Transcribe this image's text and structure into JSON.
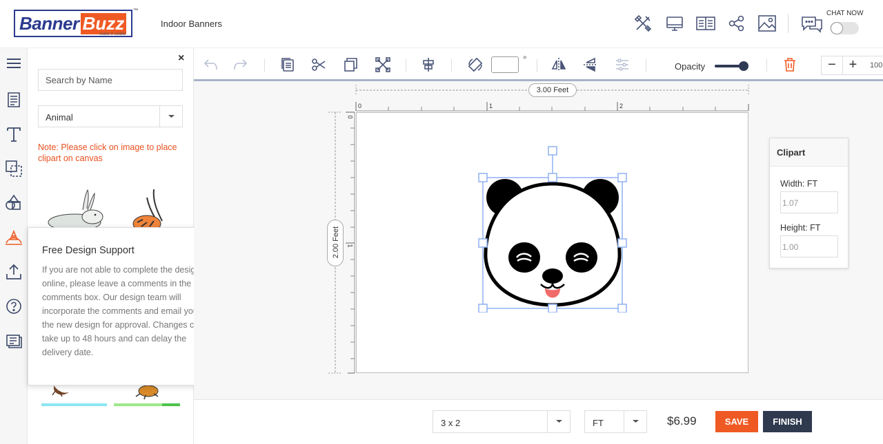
{
  "header": {
    "logo": {
      "part1": "Banner",
      "part2": "Buzz",
      "tagline": "make it visible",
      "tm": "™"
    },
    "page_title": "Indoor Banners",
    "chat": {
      "label": "CHAT NOW",
      "enabled": false
    }
  },
  "side_panel": {
    "close_label": "×",
    "search_placeholder": "Search by Name",
    "category": "Animal",
    "note": "Note: Please click on image to place clipart on canvas"
  },
  "support_popup": {
    "title": "Free Design Support",
    "close_label": "×",
    "body": "If you are not able to complete the design online, please leave a comments in the comments box. Our design team will incorporate the comments and email you the new design for approval. Changes can take up to 48 hours and can delay the delivery date."
  },
  "toolbar": {
    "rotation_unit": "°",
    "opacity_label": "Opacity",
    "opacity_value": 1.0,
    "zoom_minus": "−",
    "zoom_plus": "+",
    "zoom_value": "100"
  },
  "canvas": {
    "width_label": "3.00 Feet",
    "height_label": "2.00 Feet",
    "ruler_x": [
      "0",
      "1",
      "2"
    ],
    "ruler_y": [
      "0",
      "1"
    ]
  },
  "clipart_panel": {
    "title": "Clipart",
    "width_label": "Width: FT",
    "width_value": "1.07",
    "height_label": "Height: FT",
    "height_value": "1.00"
  },
  "bottom": {
    "size": "3 x 2",
    "unit": "FT",
    "price": "$6.99",
    "save_label": "SAVE",
    "finish_label": "FINISH"
  },
  "colors": {
    "accent": "#ef5a24",
    "brand_blue": "#2b3a8f",
    "dark_button": "#2f3a4f",
    "icon": "#4a5578"
  }
}
